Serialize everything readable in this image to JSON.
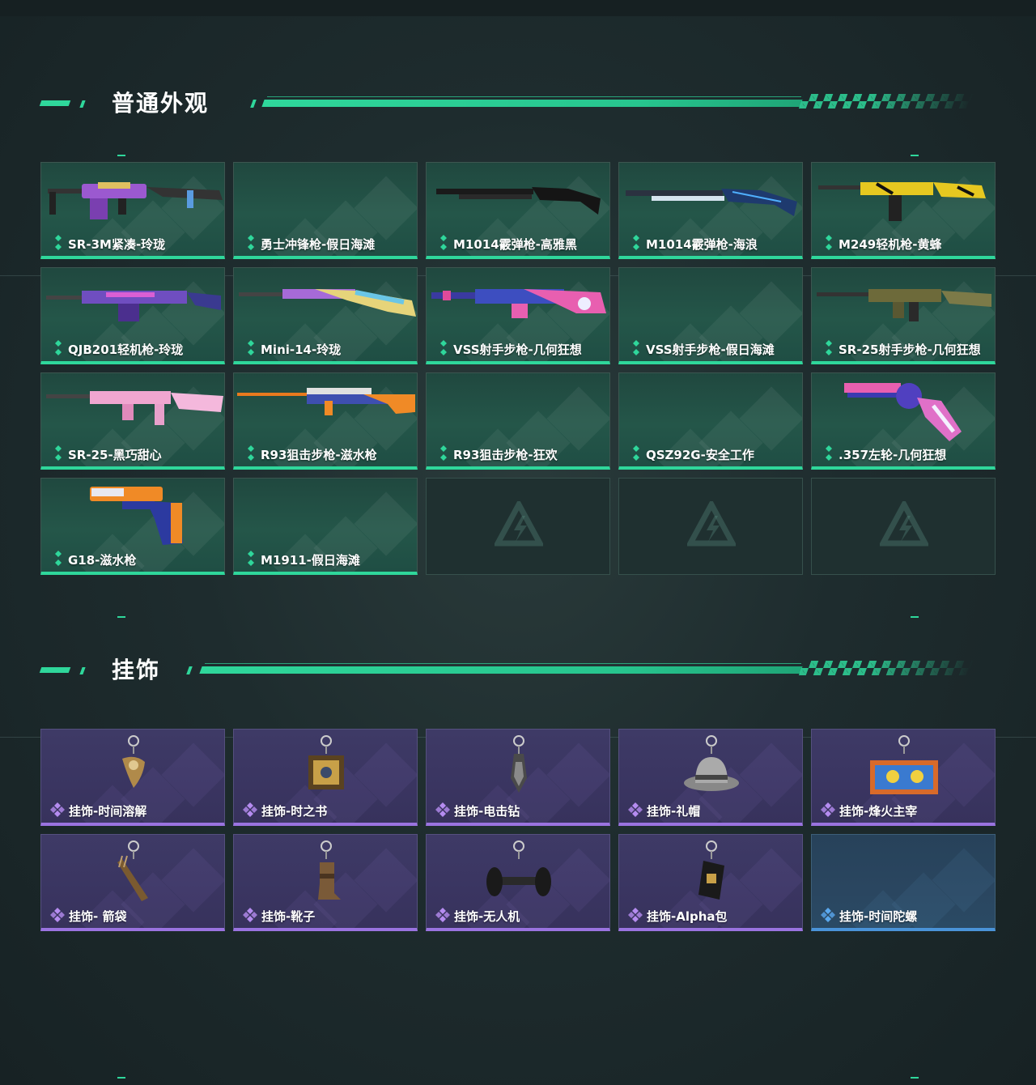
{
  "sections": [
    {
      "title": "普通外观"
    },
    {
      "title": "挂饰"
    }
  ],
  "skins": [
    {
      "label": "SR-3M紧凑-玲珑",
      "art": "rifle-purple-gold"
    },
    {
      "label": "勇士冲锋枪-假日海滩",
      "art": "none"
    },
    {
      "label": "M1014霰弹枪-高雅黑",
      "art": "shotgun-black"
    },
    {
      "label": "M1014霰弹枪-海浪",
      "art": "shotgun-blue"
    },
    {
      "label": "M249轻机枪-黄蜂",
      "art": "lmg-yellow"
    },
    {
      "label": "QJB201轻机枪-玲珑",
      "art": "lmg-purple"
    },
    {
      "label": "Mini-14-玲珑",
      "art": "rifle-pastel"
    },
    {
      "label": "VSS射手步枪-几何狂想",
      "art": "rifle-pink-blue"
    },
    {
      "label": "VSS射手步枪-假日海滩",
      "art": "none"
    },
    {
      "label": "SR-25射手步枪-几何狂想",
      "art": "rifle-camo"
    },
    {
      "label": "SR-25-黑巧甜心",
      "art": "rifle-pink"
    },
    {
      "label": "R93狙击步枪-滋水枪",
      "art": "sniper-orange"
    },
    {
      "label": "R93狙击步枪-狂欢",
      "art": "none"
    },
    {
      "label": "QSZ92G-安全工作",
      "art": "none"
    },
    {
      "label": ".357左轮-几何狂想",
      "art": "revolver-pink"
    },
    {
      "label": "G18-滋水枪",
      "art": "pistol-orange"
    },
    {
      "label": "M1911-假日海滩",
      "art": "none"
    }
  ],
  "skin_empty_slots": 3,
  "charms": [
    {
      "label": "挂饰-时间溶解",
      "rarity": "purple",
      "icon": "melting-clock-icon"
    },
    {
      "label": "挂饰-时之书",
      "rarity": "purple",
      "icon": "book-icon"
    },
    {
      "label": "挂饰-电击钻",
      "rarity": "purple",
      "icon": "drill-icon"
    },
    {
      "label": "挂饰-礼帽",
      "rarity": "purple",
      "icon": "hat-icon"
    },
    {
      "label": "挂饰-烽火主宰",
      "rarity": "purple",
      "icon": "container-icon"
    },
    {
      "label": "挂饰- 箭袋",
      "rarity": "purple",
      "icon": "quiver-icon"
    },
    {
      "label": "挂饰-靴子",
      "rarity": "purple",
      "icon": "boot-icon"
    },
    {
      "label": "挂饰-无人机",
      "rarity": "purple",
      "icon": "drone-icon"
    },
    {
      "label": "挂饰-Alpha包",
      "rarity": "purple",
      "icon": "pouch-icon"
    },
    {
      "label": "挂饰-时间陀螺",
      "rarity": "blue",
      "icon": "none"
    }
  ],
  "colors": {
    "accent_green": "#2fd79b",
    "rarity_purple": "#9a73e0",
    "rarity_blue": "#4a93d8",
    "background": "#1e2c2e"
  }
}
